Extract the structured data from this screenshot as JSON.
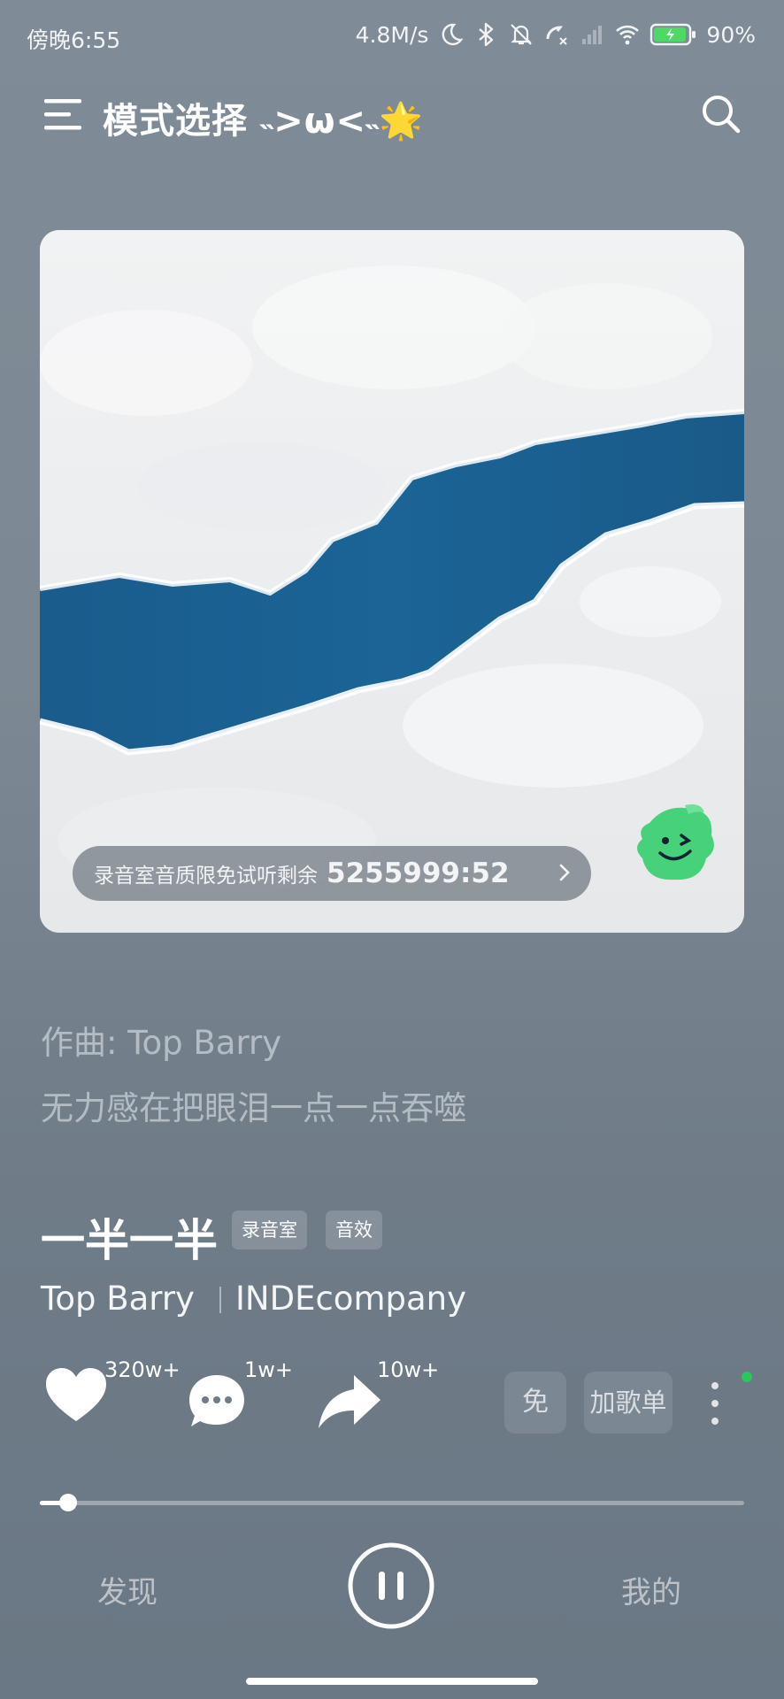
{
  "status_bar": {
    "time": "傍晚6:55",
    "net_speed": "4.8M/s",
    "battery": "90%",
    "battery_level": 0.9
  },
  "header": {
    "title": "模式选择 ˵>ω<˵🌟",
    "menu_icon": "menu-icon",
    "search_icon": "search-icon"
  },
  "cover": {
    "trial_text": "录音室音质限免试听剩余",
    "trial_countdown": "5255999:52",
    "mascot_icon": "smiley-mascot-icon"
  },
  "lyrics": {
    "composer": "作曲: Top Barry",
    "line": "无力感在把眼泪一点一点吞噬"
  },
  "song": {
    "title": "一半一半",
    "tags": [
      "录音室",
      "音效"
    ],
    "artists": [
      "Top Barry",
      "INDEcompany"
    ]
  },
  "actions": {
    "like_count": "320w+",
    "comment_count": "1w+",
    "share_count": "10w+",
    "free_label": "免",
    "add_playlist_label": "加歌单"
  },
  "player": {
    "progress": 0.04,
    "state": "playing"
  },
  "nav": {
    "discover": "发现",
    "mine": "我的"
  },
  "colors": {
    "background": "#7c8893",
    "accent_dot": "#26c95a",
    "water": "#1a5f8f"
  }
}
